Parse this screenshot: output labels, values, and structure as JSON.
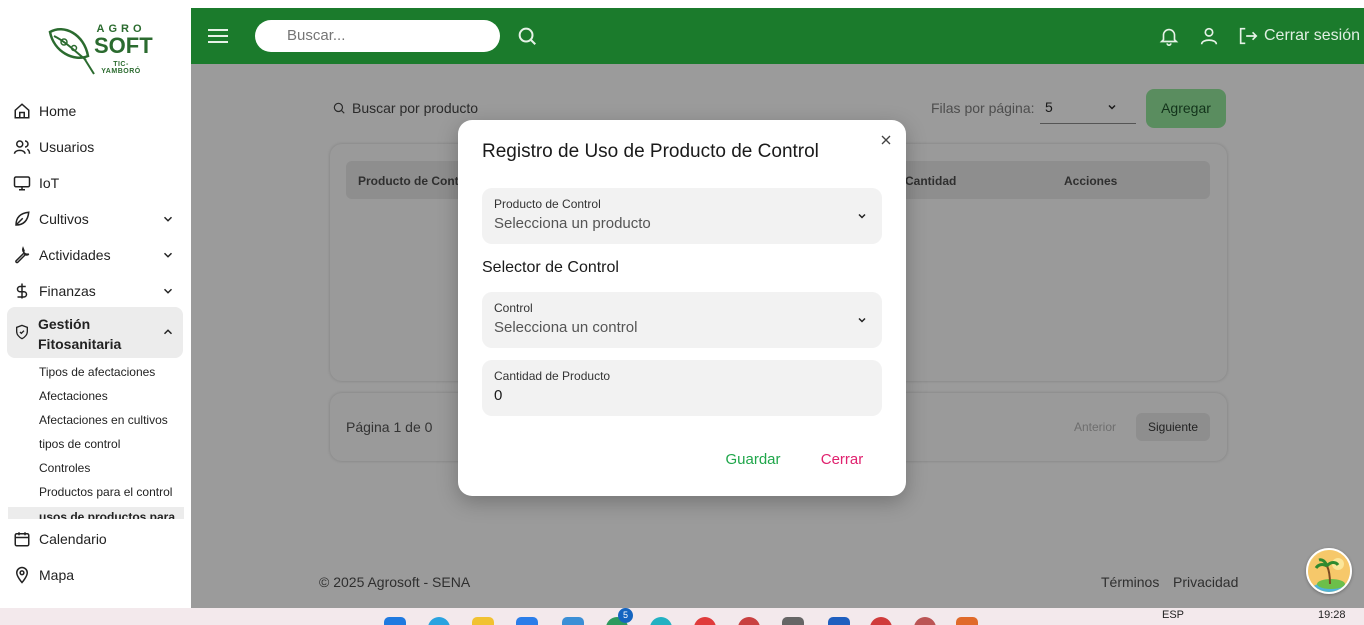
{
  "logo": {
    "line1": "AGRO",
    "line2": "SOFT",
    "line3": "TIC-YAMBORÓ"
  },
  "header": {
    "search_placeholder": "Buscar...",
    "logout_label": "Cerrar sesión"
  },
  "sidebar": {
    "items": [
      {
        "label": "Home",
        "icon": "home-icon"
      },
      {
        "label": "Usuarios",
        "icon": "users-icon"
      },
      {
        "label": "IoT",
        "icon": "monitor-icon"
      },
      {
        "label": "Cultivos",
        "icon": "leaf-icon",
        "expandable": true
      },
      {
        "label": "Actividades",
        "icon": "wrench-icon",
        "expandable": true
      },
      {
        "label": "Finanzas",
        "icon": "dollar-icon",
        "expandable": true
      }
    ],
    "active_group": {
      "label": "Gestión Fitosanitaria",
      "icon": "shield-icon"
    },
    "subitems": [
      "Tipos de afectaciones",
      "Afectaciones",
      "Afectaciones en cultivos",
      "tipos de control",
      "Controles",
      "Productos para el control"
    ],
    "active_subitem": "usos de productos para el",
    "bottom_items": [
      {
        "label": "Calendario",
        "icon": "calendar-icon"
      },
      {
        "label": "Mapa",
        "icon": "map-pin-icon"
      }
    ]
  },
  "main": {
    "search_placeholder": "Buscar por producto",
    "rows_label": "Filas por página:",
    "rows_value": "5",
    "add_label": "Agregar",
    "columns": [
      "Producto de Contr",
      "Cantidad",
      "Acciones"
    ],
    "pager_text": "Página 1 de 0",
    "prev_label": "Anterior",
    "next_label": "Siguiente"
  },
  "footer": {
    "copyright": "© 2025 Agrosoft - SENA",
    "terms": "Términos",
    "privacy": "Privacidad"
  },
  "modal": {
    "title": "Registro de Uso de Producto de Control",
    "product_label": "Producto de Control",
    "product_placeholder": "Selecciona un producto",
    "section_label": "Selector de Control",
    "control_label": "Control",
    "control_placeholder": "Selecciona un control",
    "quantity_label": "Cantidad de Producto",
    "quantity_value": "0",
    "save_label": "Guardar",
    "close_label": "Cerrar"
  },
  "taskbar": {
    "lang": "ESP",
    "time": "19:28",
    "badge_count": "5"
  },
  "colors": {
    "header_green": "#1b7b2c",
    "save_green": "#1fa64a",
    "close_pink": "#e0216e",
    "overlay_gray": "#9b9b9b"
  }
}
